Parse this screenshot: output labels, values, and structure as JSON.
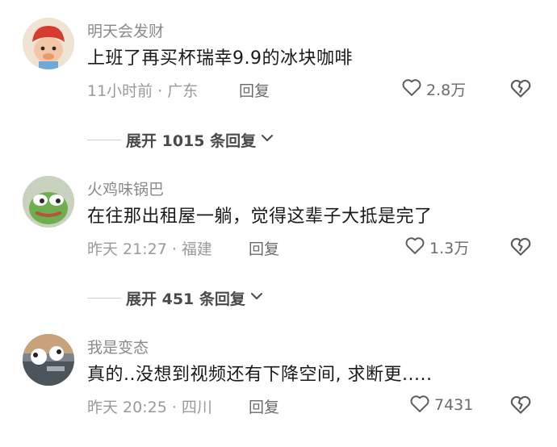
{
  "comments": [
    {
      "username": "明天会发财",
      "text": "上班了再买杯瑞幸9.9的冰块咖啡",
      "meta": "11小时前 · 广东",
      "reply_label": "回复",
      "likes": "2.8万",
      "expand_label": "展开 1015 条回复"
    },
    {
      "username": "火鸡味锅巴",
      "text": "在往那出租屋一躺，觉得这辈子大抵是完了",
      "meta": "昨天 21:27 · 福建",
      "reply_label": "回复",
      "likes": "1.3万",
      "expand_label": "展开 451 条回复"
    },
    {
      "username": "我是变态",
      "text": "真的..没想到视频还有下降空间, 求断更.....",
      "meta": "昨天 20:25 · 四川",
      "reply_label": "回复",
      "likes": "7431"
    }
  ],
  "icons": {
    "like": "heart-outline-icon",
    "dislike": "broken-heart-icon",
    "expand": "chevron-down-icon"
  },
  "colors": {
    "avatar1_bg": "#e9d9c4",
    "avatar2_bg": "#b7c2a8",
    "avatar3_bg": "#8a8f95"
  }
}
